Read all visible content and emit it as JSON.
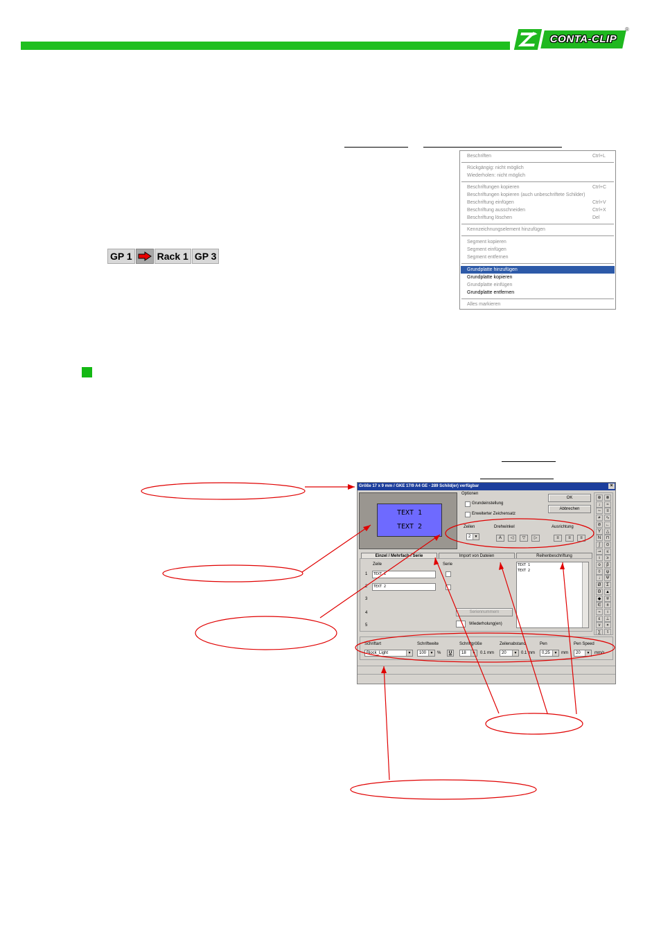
{
  "logo": {
    "text": "CONTA-CLIP",
    "registered": "®"
  },
  "gp_tabs": {
    "tab1": "GP 1",
    "tab2": "Rack 1",
    "tab3": "GP 3"
  },
  "context_menu": {
    "items": [
      {
        "label": "Beschriften",
        "shortcut": "Ctrl+L"
      },
      {
        "label": "Rückgängig: nicht möglich",
        "shortcut": ""
      },
      {
        "label": "Wiederholen: nicht möglich",
        "shortcut": ""
      },
      {
        "label": "Beschriftungen kopieren",
        "shortcut": "Ctrl+C"
      },
      {
        "label": "Beschriftungen kopieren (auch unbeschriftete Schilder)",
        "shortcut": ""
      },
      {
        "label": "Beschriftung einfügen",
        "shortcut": "Ctrl+V"
      },
      {
        "label": "Beschriftung ausschneiden",
        "shortcut": "Ctrl+X"
      },
      {
        "label": "Beschriftung löschen",
        "shortcut": "Del"
      },
      {
        "label": "Kennzeichnungselement hinzufügen",
        "shortcut": ""
      },
      {
        "label": "Segment kopieren",
        "shortcut": ""
      },
      {
        "label": "Segment einfügen",
        "shortcut": ""
      },
      {
        "label": "Segment entfernen",
        "shortcut": ""
      },
      {
        "label": "Grundplatte hinzufügen",
        "shortcut": ""
      },
      {
        "label": "Grundplatte kopieren",
        "shortcut": ""
      },
      {
        "label": "Grundplatte einfügen",
        "shortcut": ""
      },
      {
        "label": "Grundplatte entfernen",
        "shortcut": ""
      },
      {
        "label": "Alles markieren",
        "shortcut": ""
      }
    ]
  },
  "dialog": {
    "title": "Größe 17 x 9 mm / GKE 17/9 A4 GE - 289 Schild(er) verfügbar",
    "preview": {
      "line1": "TEXT 1",
      "line2": "TEXT 2"
    },
    "options_label": "Optionen",
    "opt_basic": "Grundeinstellung",
    "opt_extended": "Erweiterter Zeichensatz",
    "ok_button": "OK",
    "cancel_button": "Abbrechen",
    "lines_label": "Zeilen",
    "lines_value": "2",
    "rotation_label": "Drehwinkel",
    "alignment_label": "Ausrichtung",
    "tabs": {
      "single": "Einzel / Mehrfach / Serie",
      "import": "Import von Dateien",
      "row": "Reihenbeschriftung"
    },
    "line_header": "Zeile",
    "series_header": "Serie",
    "row_numbers": [
      "1",
      "2",
      "3",
      "4",
      "5"
    ],
    "line1_value": "TEXT 1",
    "line2_value": "TEXT 2",
    "series_numbers_button": "Seriennummern",
    "repetitions_label": "Wiederholung(en)",
    "row_text": [
      "TEXT 1",
      "TEXT 2"
    ],
    "font": {
      "font_label": "Schriftart",
      "font_value": "Block_Light",
      "width_label": "Schriftweite",
      "width_value": "100",
      "width_unit": "%",
      "underline": "U",
      "size_label": "Schriftgröße",
      "size_value": "18",
      "size_unit": "0.1 mm",
      "spacing_label": "Zeilenabstand",
      "spacing_value": "20",
      "spacing_unit": "0.1 mm",
      "pen_label": "Pen",
      "pen_value": "0,25",
      "pen_unit": "mm",
      "speed_label": "Pen Speed",
      "speed_value": "20",
      "speed_unit": "mm/s"
    },
    "symbols": [
      "⊕",
      "⊗",
      "↓",
      "≈",
      "∼",
      "≡",
      "≠",
      "∿",
      "⊘",
      "←",
      "Υ",
      "△",
      "N",
      "⊓",
      "ʃ",
      "⊙",
      "⊸",
      "≤",
      "ι",
      "≥",
      "ο",
      "β",
      "◊",
      "ψ",
      "↓",
      "Ψ",
      "Ø",
      "Σ",
      "Θ",
      "▲",
      "◆",
      "∓",
      "∈",
      "±",
      "⌁",
      "ι",
      "ε",
      "⊥",
      "ν",
      "⋄",
      "∑",
      "τ"
    ]
  },
  "colors": {
    "green": "#1fbf1f",
    "highlight": "#2d5aa8",
    "annotation": "#e00000",
    "preview": "#6e6aff"
  }
}
